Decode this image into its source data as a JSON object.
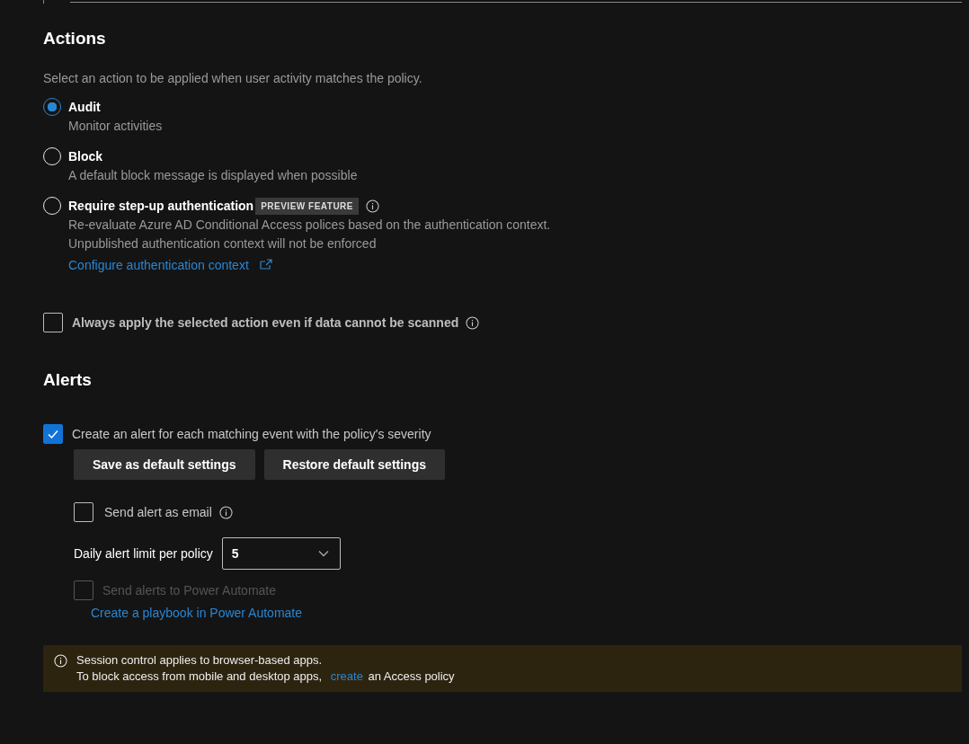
{
  "actions": {
    "title": "Actions",
    "description": "Select an action to be applied when user activity matches the policy.",
    "options": [
      {
        "label": "Audit",
        "description": [
          "Monitor activities"
        ],
        "selected": true,
        "info": false
      },
      {
        "label": "Block",
        "description": [
          "A default block message is displayed when possible"
        ],
        "selected": false,
        "info": false
      },
      {
        "label": "Require step-up authentication",
        "badge": "PREVIEW FEATURE",
        "description": [
          "Re-evaluate Azure AD Conditional Access polices based on the authentication context.",
          "Unpublished authentication context will not be enforced"
        ],
        "link": "Configure authentication context",
        "selected": false,
        "info": true
      }
    ]
  },
  "always_apply": {
    "label": "Always apply the selected action even if data cannot be scanned",
    "checked": false
  },
  "alerts": {
    "title": "Alerts",
    "create_alert": {
      "label": "Create an alert for each matching event with the policy's severity",
      "checked": true
    },
    "buttons": [
      "Save as default settings",
      "Restore default settings"
    ],
    "send_email": {
      "label": "Send alert as email",
      "checked": false
    },
    "daily_limit": {
      "label": "Daily alert limit per policy",
      "value": "5"
    },
    "power_automate": {
      "label": "Send alerts to Power Automate",
      "checked": false,
      "disabled": true
    },
    "playbook_link": "Create a playbook in Power Automate"
  },
  "notice": {
    "line_1": "Session control applies to browser-based apps.",
    "line_2_before": "To block access from mobile and desktop apps,",
    "line_2_link": "create",
    "line_2_after": "an Access policy"
  }
}
